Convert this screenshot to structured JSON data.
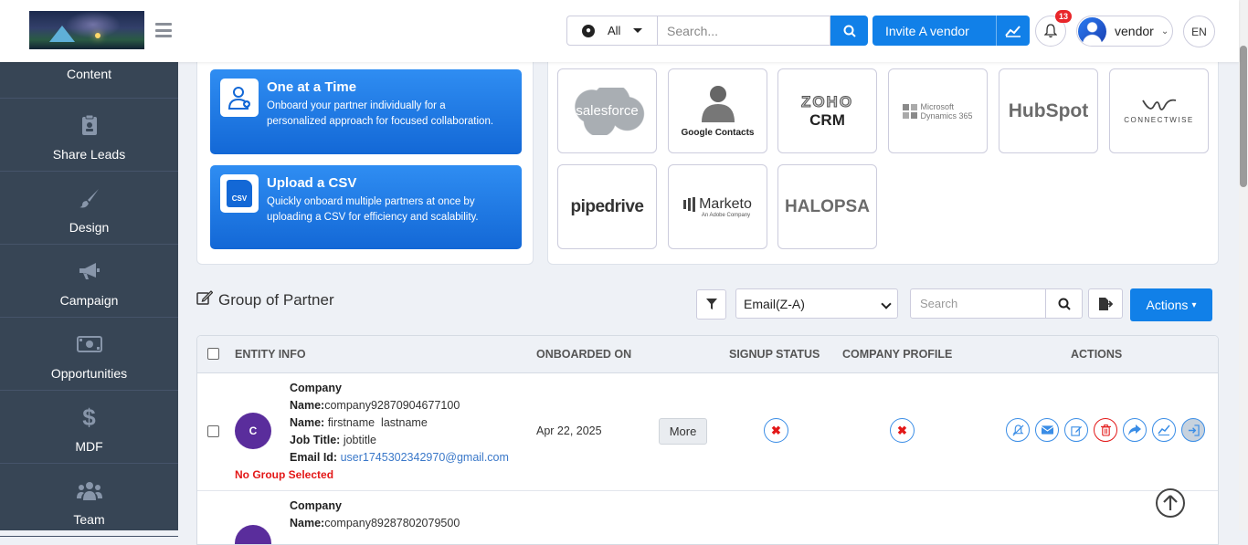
{
  "header": {
    "search_scope": "All",
    "search_placeholder": "Search...",
    "invite_label": "Invite A vendor",
    "notification_count": "13",
    "user_name": "vendor",
    "language": "EN"
  },
  "sidebar": {
    "items": [
      {
        "label": "Content",
        "icon": "content-icon"
      },
      {
        "label": "Share Leads",
        "icon": "clipboard-icon"
      },
      {
        "label": "Design",
        "icon": "brush-icon"
      },
      {
        "label": "Campaign",
        "icon": "megaphone-icon"
      },
      {
        "label": "Opportunities",
        "icon": "money-icon"
      },
      {
        "label": "MDF",
        "icon": "dollar-icon"
      },
      {
        "label": "Team",
        "icon": "team-icon"
      }
    ]
  },
  "onboard": {
    "one": {
      "title": "One at a Time",
      "desc": "Onboard your partner individually for a personalized approach for focused collaboration."
    },
    "csv": {
      "title": "Upload a CSV",
      "desc": "Quickly onboard multiple partners at once by uploading a CSV for efficiency and scalability.",
      "icon_text": "CSV"
    }
  },
  "crms": {
    "salesforce": "salesforce",
    "google": "Google Contacts",
    "zoho": "ZOHO",
    "zoho_sub": "CRM",
    "dynamics_1": "Microsoft",
    "dynamics_2": "Dynamics 365",
    "hubspot": "HubSpot",
    "connectwise": "CONNECTWISE",
    "pipedrive": "pipedrive",
    "marketo": "Marketo",
    "marketo_sub": "An Adobe Company",
    "halopsa": "HALOPSA"
  },
  "section": {
    "title": "Group of Partner",
    "sort_value": "Email(Z-A)",
    "search_placeholder": "Search",
    "actions_label": "Actions"
  },
  "table": {
    "headers": {
      "entity": "ENTITY INFO",
      "onboarded": "ONBOARDED ON",
      "signup": "SIGNUP STATUS",
      "company_profile": "COMPANY PROFILE",
      "actions": "ACTIONS"
    },
    "rows": [
      {
        "initial": "C",
        "company_label": "Company",
        "name_label": "Name:",
        "company": "company92870904677100",
        "person_label": "Name:",
        "person": "firstname  lastname",
        "job_label": "Job Title:",
        "job": "jobtitle",
        "email_label": "Email Id:",
        "email": "user1745302342970@gmail.com",
        "group": "No Group Selected",
        "onboarded": "Apr 22, 2025",
        "more": "More",
        "signup": "✖",
        "profile": "✖"
      },
      {
        "company_label": "Company",
        "name_label": "Name:",
        "company": "company89287802079500"
      }
    ]
  }
}
